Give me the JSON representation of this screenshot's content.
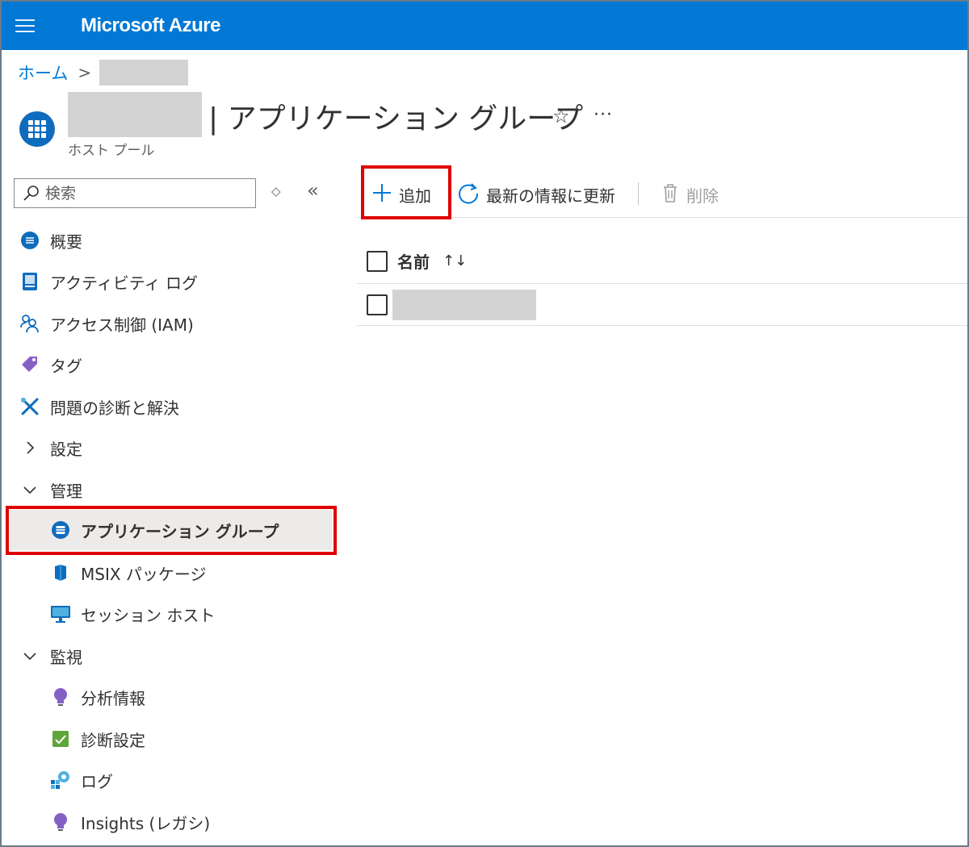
{
  "topbar": {
    "brand": "Microsoft Azure"
  },
  "breadcrumb": {
    "home": "ホーム",
    "separator": ">"
  },
  "header": {
    "title": "| アプリケーション グループ",
    "subtitle": "ホスト プール",
    "star_glyph": "☆",
    "more_glyph": "···"
  },
  "sidebar": {
    "search_placeholder": "検索",
    "options_glyph": "◇",
    "collapse_glyph": "«",
    "items": [
      {
        "label": "概要"
      },
      {
        "label": "アクティビティ ログ"
      },
      {
        "label": "アクセス制御 (IAM)"
      },
      {
        "label": "タグ"
      },
      {
        "label": "問題の診断と解決"
      },
      {
        "label": "設定"
      },
      {
        "label": "管理"
      },
      {
        "label": "アプリケーション グループ"
      },
      {
        "label": "MSIX パッケージ"
      },
      {
        "label": "セッション ホスト"
      },
      {
        "label": "監視"
      },
      {
        "label": "分析情報"
      },
      {
        "label": "診断設定"
      },
      {
        "label": "ログ"
      },
      {
        "label": "Insights (レガシ)"
      }
    ]
  },
  "toolbar": {
    "add_label": "追加",
    "refresh_label": "最新の情報に更新",
    "delete_label": "削除"
  },
  "table": {
    "columns": [
      "名前"
    ],
    "sort_glyph": "↑↓"
  },
  "colors": {
    "brand_blue": "#0078d4",
    "highlight_red": "#e00000",
    "selected_bg": "#edebe9"
  }
}
